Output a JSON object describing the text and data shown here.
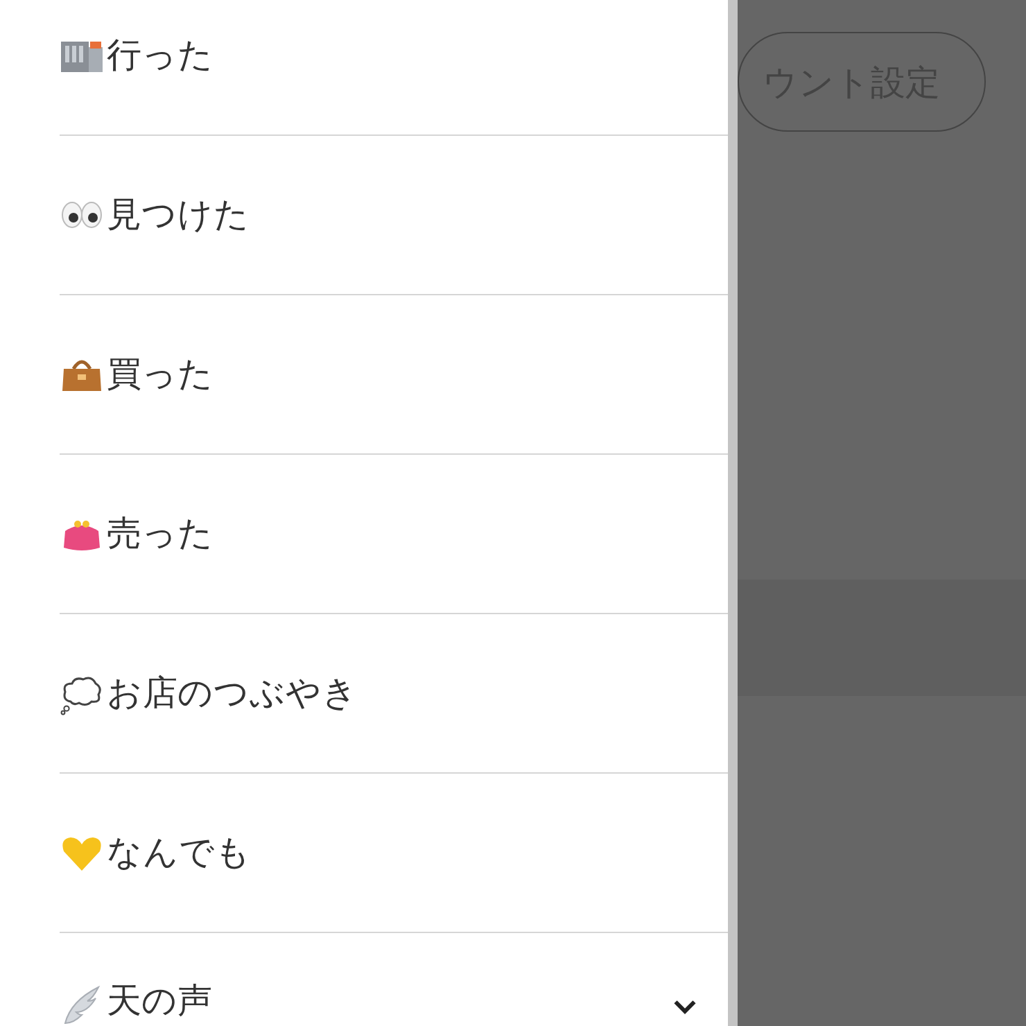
{
  "background": {
    "account_button": "ウント設定"
  },
  "drawer": {
    "items": [
      {
        "label": "行った",
        "kind": "link"
      },
      {
        "label": "見つけた",
        "kind": "link"
      },
      {
        "label": "買った",
        "kind": "link"
      },
      {
        "label": "売った",
        "kind": "link"
      },
      {
        "label": "お店のつぶやき",
        "kind": "link"
      },
      {
        "label": "なんでも",
        "kind": "link"
      },
      {
        "label": "天の声",
        "kind": "group",
        "expanded": false
      }
    ]
  }
}
